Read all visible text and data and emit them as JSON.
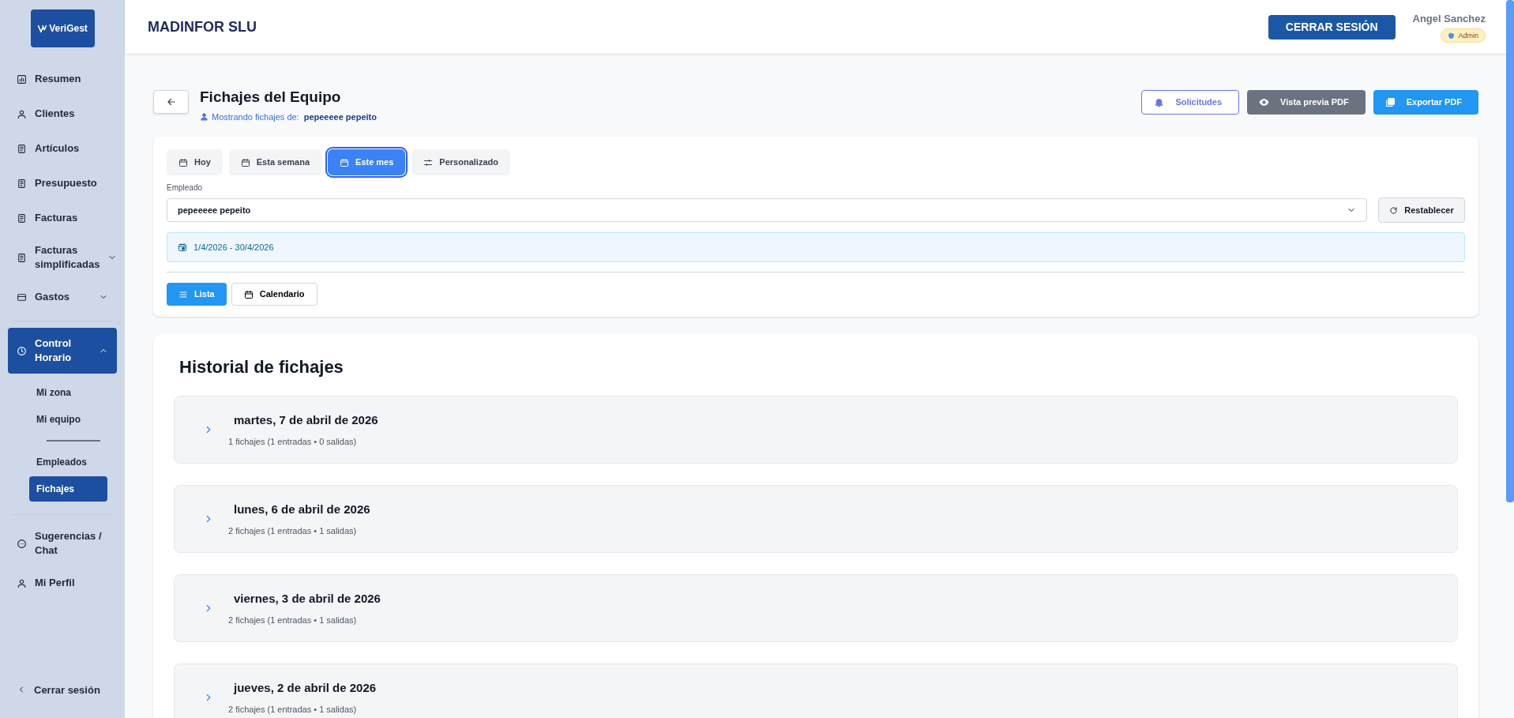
{
  "sidebar": {
    "logo": "VeriGest",
    "items": [
      {
        "label": "Resumen",
        "selected": false
      },
      {
        "label": "Clientes",
        "selected": false
      },
      {
        "label": "Artículos",
        "selected": false
      },
      {
        "label": "Presupuesto",
        "selected": false
      },
      {
        "label": "Facturas",
        "selected": false
      },
      {
        "label": "Facturas simplificadas",
        "selected": false,
        "expanded": false
      },
      {
        "label": "Gastos",
        "selected": false,
        "expanded": false
      },
      {
        "label": "Control Horario",
        "selected": true,
        "expanded": true,
        "children": [
          {
            "label": "Mi zona",
            "selected": false
          },
          {
            "label": "Mi equipo",
            "selected": false
          },
          {
            "kind": "divider"
          },
          {
            "label": "Empleados",
            "selected": false
          },
          {
            "label": "Fichajes",
            "selected": true
          }
        ]
      },
      {
        "label": "Sugerencias / Chat",
        "selected": false
      },
      {
        "label": "Mi Perfil",
        "selected": false
      }
    ],
    "logout": "Cerrar sesión"
  },
  "header": {
    "company": "MADINFOR SLU",
    "logout_button": "CERRAR SESIÓN",
    "user_name": "Angel Sanchez",
    "role": "Admin"
  },
  "page": {
    "title": "Fichajes del Equipo",
    "subtitle_label": "Mostrando fichajes de:",
    "subtitle_value": "pepeeeee pepeito",
    "actions": [
      "Solicitudes",
      "Vista previa PDF",
      "Exportar PDF"
    ]
  },
  "filters": {
    "periods": [
      {
        "label": "Hoy",
        "selected": false
      },
      {
        "label": "Esta semana",
        "selected": false
      },
      {
        "label": "Este mes",
        "selected": true
      },
      {
        "label": "Personalizado",
        "selected": false
      }
    ],
    "employee_label": "Empleado",
    "employee_value": "pepeeeee pepeito",
    "reset_button": "Restablecer",
    "date_range": "1/4/2026 - 30/4/2026",
    "views": [
      {
        "label": "Lista",
        "selected": true
      },
      {
        "label": "Calendario",
        "selected": false
      }
    ]
  },
  "history": {
    "title": "Historial de fichajes",
    "days": [
      {
        "date": "martes, 7 de abril de 2026",
        "summary": "1 fichajes (1 entradas • 0 salidas)",
        "expanded": false
      },
      {
        "date": "lunes, 6 de abril de 2026",
        "summary": "2 fichajes (1 entradas • 1 salidas)",
        "expanded": false
      },
      {
        "date": "viernes, 3 de abril de 2026",
        "summary": "2 fichajes (1 entradas • 1 salidas)",
        "expanded": false
      },
      {
        "date": "jueves, 2 de abril de 2026",
        "summary": "2 fichajes (1 entradas • 1 salidas)",
        "expanded": false
      }
    ]
  }
}
